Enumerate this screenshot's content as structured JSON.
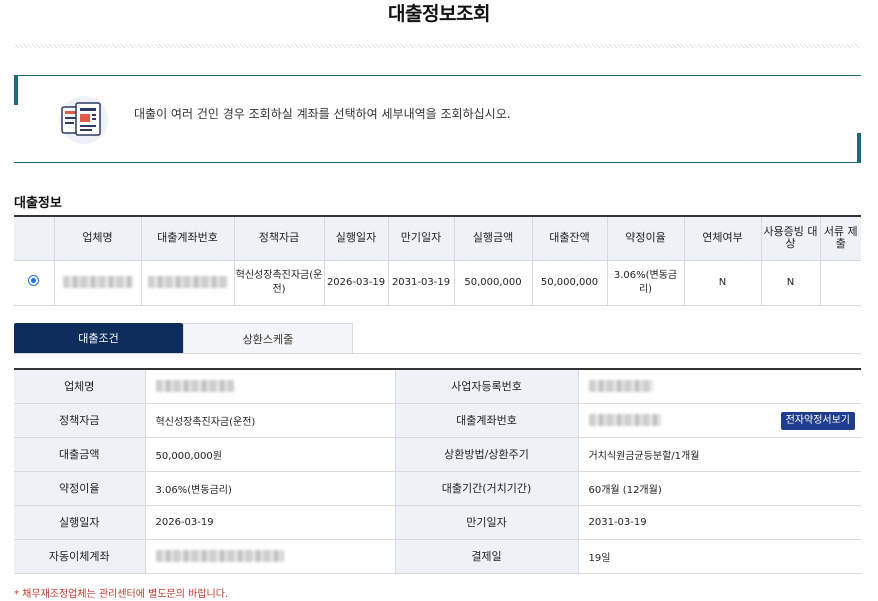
{
  "page": {
    "title": "대출정보조회"
  },
  "notice": {
    "message": "대출이 여러 건인 경우 조회하실 계좌를 선택하여 세부내역을 조회하십시오."
  },
  "loan_info": {
    "section_title": "대출정보",
    "headers": [
      "업체명",
      "대출계좌번호",
      "정책자금",
      "실행일자",
      "만기일자",
      "실행금액",
      "대출잔액",
      "약정이율",
      "연체여부",
      "사용증빙 대상",
      "서류 제출"
    ],
    "rows": [
      {
        "policy_fund": "혁신성장촉진자금(운전)",
        "exec_date": "2026-03-19",
        "maturity_date": "2031-03-19",
        "exec_amount": "50,000,000",
        "balance": "50,000,000",
        "rate": "3.06%(변동금리)",
        "overdue": "N",
        "usage_proof": "N",
        "doc_submit": ""
      }
    ]
  },
  "tabs": {
    "conditions": "대출조건",
    "schedule": "상환스케줄"
  },
  "detail": {
    "company_label": "업체명",
    "biz_reg_label": "사업자등록번호",
    "policy_fund_label": "정책자금",
    "policy_fund_value": "혁신성장촉진자금(운전)",
    "account_label": "대출계좌번호",
    "contract_button": "전자약정서보기",
    "amount_label": "대출금액",
    "amount_value": "50,000,000원",
    "repay_label": "상환방법/상환주기",
    "repay_value": "거치식원금균등분할/1개월",
    "rate_label": "약정이율",
    "rate_value": "3.06%(변동금리)",
    "period_label": "대출기간(거치기간)",
    "period_value": "60개월 (12개월)",
    "exec_label": "실행일자",
    "exec_value": "2026-03-19",
    "maturity_label": "만기일자",
    "maturity_value": "2031-03-19",
    "autodebit_label": "자동이체계좌",
    "payday_label": "결제일",
    "payday_value": "19일"
  },
  "footnote": "* 채무재조정업체는 관리센터에 별도문의 바랍니다.",
  "colors": {
    "navy": "#0e2d5a",
    "teal": "#1b6b7a",
    "button": "#1e3d8f",
    "note": "#c0392b"
  }
}
